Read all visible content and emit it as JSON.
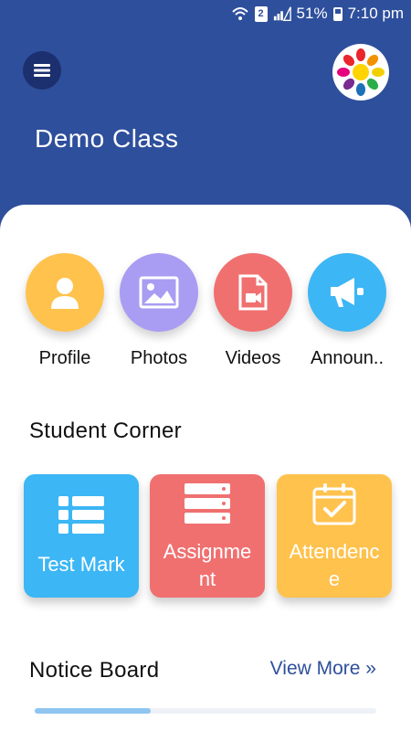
{
  "status_bar": {
    "battery": "51%",
    "sim_number": "2",
    "time": "7:10 pm"
  },
  "header": {
    "title": "Demo Class"
  },
  "quick_links": [
    {
      "label": "Profile",
      "color": "#ffc24d",
      "icon": "user-icon"
    },
    {
      "label": "Photos",
      "color": "#a99cf3",
      "icon": "image-icon"
    },
    {
      "label": "Videos",
      "color": "#f07070",
      "icon": "video-file-icon"
    },
    {
      "label": "Announ..",
      "color": "#3cb6f4",
      "icon": "megaphone-icon"
    }
  ],
  "student_corner": {
    "title": "Student Corner",
    "tiles": [
      {
        "label": "Test Mark",
        "color": "#3cb6f4",
        "icon": "list-icon"
      },
      {
        "label": "Assignme\nnt",
        "color": "#f07070",
        "icon": "stack-icon"
      },
      {
        "label": "Attendenc\ne",
        "color": "#ffc24d",
        "icon": "calendar-check-icon"
      }
    ]
  },
  "notice_board": {
    "title": "Notice Board",
    "view_more": "View More »",
    "progress": 0.34
  }
}
